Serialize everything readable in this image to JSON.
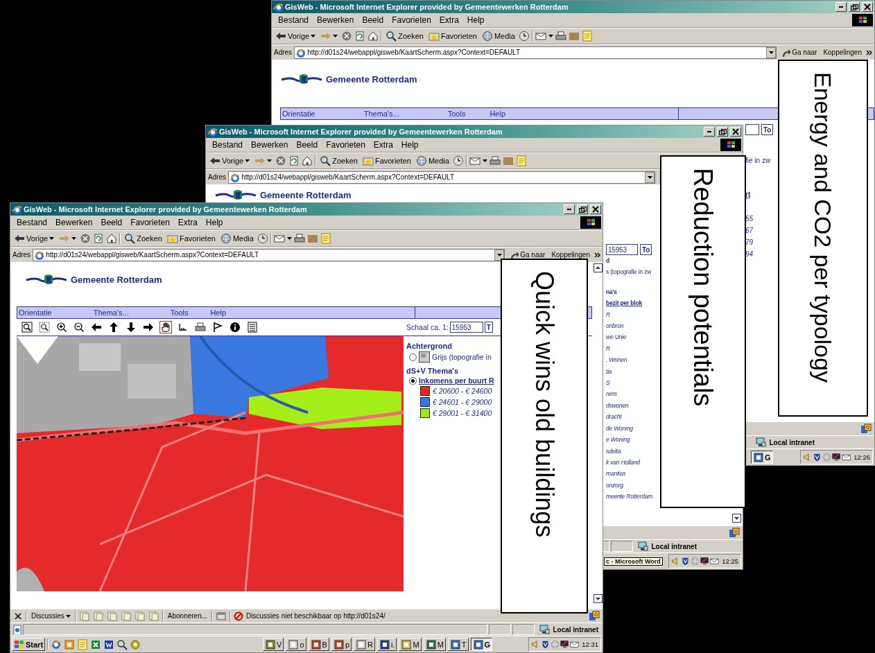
{
  "windows": [
    {
      "title": "GisWeb - Microsoft Internet Explorer provided by Gemeentewerken Rotterdam",
      "menu": [
        "Bestand",
        "Bewerken",
        "Beeld",
        "Favorieten",
        "Extra",
        "Help"
      ],
      "toolbar": {
        "back": "Vorige",
        "search": "Zoeken",
        "favorites": "Favorieten",
        "media": "Media"
      },
      "address": {
        "label": "Adres",
        "url": "http://d01s24/webappl/gisweb/KaartScherm.aspx?Context=DEFAULT",
        "go": "Ga naar",
        "links": "Koppelingen"
      },
      "site": {
        "logo": "Gemeente Rotterdam",
        "nav": [
          "Orientatie",
          "Thema's...",
          "Tools",
          "Help"
        ]
      },
      "strip": {
        "button": "To",
        "items": [
          {
            "text": "fie in zw",
            "kind": "plain"
          },
          {
            "text": "rt",
            "kind": "link"
          },
          {
            "text": "55",
            "kind": "item"
          },
          {
            "text": "67",
            "kind": "item"
          },
          {
            "text": "79",
            "kind": "item"
          },
          {
            "text": "94",
            "kind": "item"
          }
        ]
      },
      "status": {
        "zone": "Local intranet"
      },
      "taskbar": {
        "tasks": [
          {
            "label": "G",
            "selected": true
          }
        ],
        "clock": "12:26"
      }
    },
    {
      "title": "GisWeb - Microsoft Internet Explorer provided by Gemeentewerken Rotterdam",
      "menu": [
        "Bestand",
        "Bewerken",
        "Beeld",
        "Favorieten",
        "Extra",
        "Help"
      ],
      "toolbar": {
        "back": "Vorige",
        "search": "Zoeken",
        "favorites": "Favorieten",
        "media": "Media"
      },
      "address": {
        "label": "Adres",
        "url": "http://d01s24/webappl/gisweb/KaartScherm.aspx?Context=DEFAULT"
      },
      "site": {
        "logo": "Gemeente Rotterdam"
      },
      "strip": {
        "scale_value": "15953",
        "button": "To",
        "items": [
          {
            "text": "d",
            "kind": "heading"
          },
          {
            "text": "s (topografie in zw",
            "kind": "plain"
          },
          {
            "text": "na's",
            "kind": "heading"
          },
          {
            "text": "bezit per blok",
            "kind": "link"
          },
          {
            "text": "R",
            "kind": "item"
          },
          {
            "text": "onbron",
            "kind": "item"
          },
          {
            "text": "we Unie",
            "kind": "item"
          },
          {
            "text": "R",
            "kind": "item"
          },
          {
            "text": ". Wonen",
            "kind": "item"
          },
          {
            "text": "tia",
            "kind": "item"
          },
          {
            "text": "S",
            "kind": "item"
          },
          {
            "text": "rens",
            "kind": "item"
          },
          {
            "text": "dswonen",
            "kind": "item"
          },
          {
            "text": "dracht",
            "kind": "item"
          },
          {
            "text": "de Woning",
            "kind": "item"
          },
          {
            "text": "e Woning",
            "kind": "item"
          },
          {
            "text": "sdelta",
            "kind": "item"
          },
          {
            "text": "k van Holland",
            "kind": "item"
          },
          {
            "text": "manitas",
            "kind": "item"
          },
          {
            "text": "onzorg",
            "kind": "item"
          },
          {
            "text": "meente Rotterdam",
            "kind": "item"
          }
        ]
      },
      "status": {
        "zone": "Local intranet"
      },
      "taskbar": {
        "tooltip": "c - Microsoft Word",
        "clock": "12:25"
      }
    },
    {
      "title": "GisWeb - Microsoft Internet Explorer provided by Gemeentewerken Rotterdam",
      "menu": [
        "Bestand",
        "Bewerken",
        "Beeld",
        "Favorieten",
        "Extra",
        "Help"
      ],
      "toolbar": {
        "back": "Vorige",
        "search": "Zoeken",
        "favorites": "Favorieten",
        "media": "Media"
      },
      "address": {
        "label": "Adres",
        "url": "http://d01s24/webappl/gisweb/KaartScherm.aspx?Context=DEFAULT",
        "go": "Ga naar",
        "links": "Koppelingen"
      },
      "site": {
        "logo": "Gemeente Rotterdam",
        "nav": [
          "Orientatie",
          "Thema's...",
          "Tools",
          "Help"
        ]
      },
      "map_tools": [
        {
          "selected": false
        },
        {
          "selected": false
        },
        {
          "selected": false
        },
        {
          "selected": false
        },
        {
          "selected": false
        },
        {
          "selected": false
        },
        {
          "selected": false
        },
        {
          "selected": false
        },
        {
          "selected": true
        },
        {
          "selected": false
        },
        {
          "selected": false
        },
        {
          "selected": false
        },
        {
          "selected": false
        },
        {
          "selected": false
        }
      ],
      "scale": {
        "label": "Schaal ca. 1:",
        "value": "15953",
        "button": "T"
      },
      "legend": {
        "sections": [
          {
            "title": "Achtergrond",
            "items": [
              {
                "text": "Grijs (topografie in",
                "selected": false
              }
            ]
          },
          {
            "title": "dS+V Thema's",
            "items": [
              {
                "text": "Inkomens per buurt R",
                "selected": true,
                "classes": [
                  {
                    "text": "€ 20600 - € 24600",
                    "color": "#ee2222"
                  },
                  {
                    "text": "€ 24601 - € 29000",
                    "color": "#3377ee"
                  },
                  {
                    "text": "€ 29001 - € 31400",
                    "color": "#99ee11"
                  }
                ]
              }
            ]
          }
        ]
      },
      "discussion": {
        "menu": "Discussies",
        "subscribe": "Abonneren...",
        "message": "Discussies niet beschikbaar op http://d01s24/"
      },
      "status": {
        "zone": "Local intranet"
      },
      "taskbar": {
        "start": "Start",
        "tasks": [
          {
            "label": "V",
            "selected": false
          },
          {
            "label": "o",
            "selected": false
          },
          {
            "label": "B",
            "selected": false
          },
          {
            "label": "p",
            "selected": false
          },
          {
            "label": "R",
            "selected": false
          },
          {
            "label": "i.",
            "selected": false
          },
          {
            "label": "M",
            "selected": false
          },
          {
            "label": "M",
            "selected": false
          },
          {
            "label": "T",
            "selected": false
          },
          {
            "label": "G",
            "selected": true
          }
        ],
        "clock": "12:31"
      }
    }
  ],
  "callouts": [
    "Energy and CO2 per typology",
    "Reduction potentials",
    "Quick wins old buildings"
  ]
}
